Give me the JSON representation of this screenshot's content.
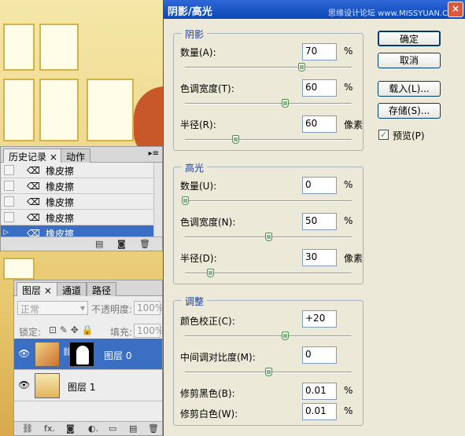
{
  "dialog": {
    "title": "阴影/高光",
    "watermark": "思缘设计论坛 www.MISSYUAN.COM",
    "buttons": {
      "ok": "确定",
      "cancel": "取消",
      "load": "载入(L)...",
      "save": "存储(S)..."
    },
    "preview": {
      "label": "预览(P)",
      "checked": true
    },
    "shadows": {
      "title": "阴影",
      "amount": {
        "label": "数量(A):",
        "value": "70",
        "unit": "%",
        "slider": 0.7
      },
      "tonal_width": {
        "label": "色调宽度(T):",
        "value": "60",
        "unit": "%",
        "slider": 0.6
      },
      "radius": {
        "label": "半径(R):",
        "value": "60",
        "unit": "像素",
        "slider": 0.3
      }
    },
    "highlights": {
      "title": "高光",
      "amount": {
        "label": "数量(U):",
        "value": "0",
        "unit": "%",
        "slider": 0.0
      },
      "tonal_width": {
        "label": "色调宽度(N):",
        "value": "50",
        "unit": "%",
        "slider": 0.5
      },
      "radius": {
        "label": "半径(D):",
        "value": "30",
        "unit": "像素",
        "slider": 0.15
      }
    },
    "adjustments": {
      "title": "调整",
      "color_correction": {
        "label": "颜色校正(C):",
        "value": "+20",
        "slider": 0.6
      },
      "midtone_contrast": {
        "label": "中间调对比度(M):",
        "value": "0",
        "slider": 0.5
      },
      "clip_black": {
        "label": "修剪黑色(B):",
        "value": "0.01",
        "unit": "%"
      },
      "clip_white": {
        "label": "修剪白色(W):",
        "value": "0.01",
        "unit": "%"
      }
    }
  },
  "history": {
    "tabs": [
      "历史记录",
      "动作"
    ],
    "items": [
      "橡皮擦",
      "橡皮擦",
      "橡皮擦",
      "橡皮擦",
      "橡皮擦"
    ],
    "selected_index": 4
  },
  "layers": {
    "tabs": [
      "图层",
      "通道",
      "路径"
    ],
    "blend_mode": "正常",
    "opacity_label": "不透明度:",
    "opacity": "100%",
    "lock_label": "锁定:",
    "fill_label": "填充:",
    "fill": "100%",
    "items": [
      {
        "name": "图层 0",
        "selected": true
      },
      {
        "name": "图层 1",
        "selected": false
      }
    ]
  },
  "colors": {
    "accent": "#3a6fc3",
    "titlebar": "#0b48b8",
    "dialog_bg": "#ece9d8"
  }
}
